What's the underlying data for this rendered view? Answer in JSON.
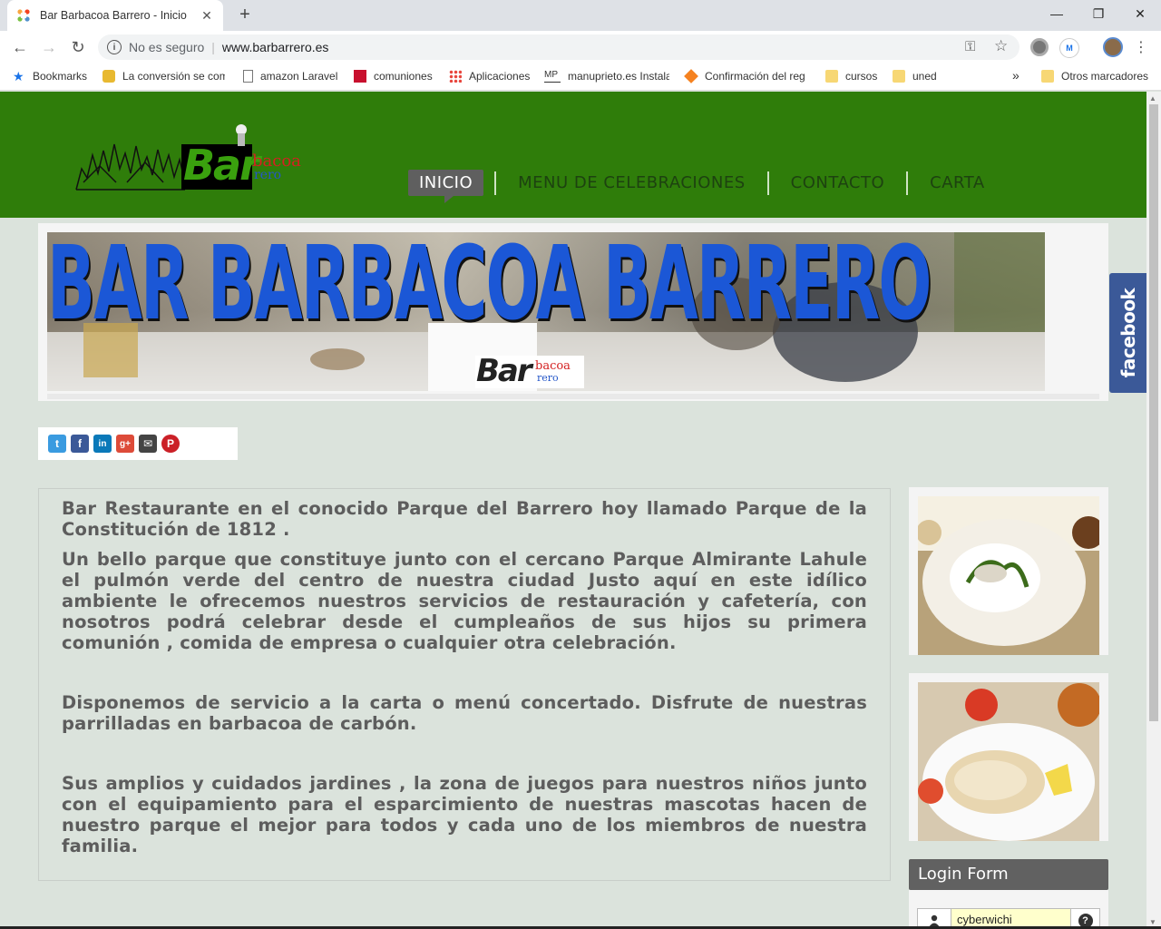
{
  "browser": {
    "tab_title": "Bar Barbacoa Barrero - Inicio",
    "tab_close": "✕",
    "new_tab": "+",
    "window_controls": {
      "minimize": "—",
      "restore": "❐",
      "close": "✕"
    },
    "security_label": "No es seguro",
    "url": "www.barbarrero.es",
    "bookmarks": [
      {
        "label": "Bookmarks",
        "icon": "star-icon"
      },
      {
        "label": "La conversión se com",
        "icon": "folder-icon"
      },
      {
        "label": "amazon Laravel",
        "icon": "page-icon"
      },
      {
        "label": "comuniones",
        "icon": "red-square-icon"
      },
      {
        "label": "Aplicaciones",
        "icon": "apps-icon"
      },
      {
        "label": "manuprieto.es Instala",
        "icon": "mp-icon"
      },
      {
        "label": "Confirmación del reg",
        "icon": "cube-icon"
      },
      {
        "label": "cursos",
        "icon": "folder-icon"
      },
      {
        "label": "uned",
        "icon": "folder-icon"
      },
      {
        "label": "»",
        "icon": "chevron-icon"
      },
      {
        "label": "Otros marcadores",
        "icon": "folder-icon"
      }
    ]
  },
  "site": {
    "logo_text": "Bar",
    "logo_sub1": "bacoa",
    "logo_sub2": "rero",
    "nav": [
      {
        "label": "INICIO",
        "active": true
      },
      {
        "label": "MENU DE CELEBRACIONES",
        "active": false
      },
      {
        "label": "CONTACTO",
        "active": false
      },
      {
        "label": "CARTA",
        "active": false
      }
    ],
    "banner_title": "BAR BARBACOA BARRERO",
    "banner_logo": "Bar",
    "banner_logo_sub1": "bacoa",
    "banner_logo_sub2": "rero",
    "facebook_tab": "facebook",
    "share_icons": [
      "t",
      "f",
      "in",
      "g+",
      "✉",
      "P"
    ],
    "paragraphs": [
      "Bar Restaurante en el conocido Parque del Barrero hoy llamado Parque de la Constitución de 1812 .",
      "Un bello parque que constituye junto con el cercano Parque Almirante Lahule el pulmón verde del centro de nuestra ciudad Justo aquí en este idílico ambiente le ofrecemos nuestros servicios de restauración y cafetería, con nosotros podrá celebrar desde el cumpleaños de sus hijos  su primera comunión , comida de empresa o cualquier otra celebración.",
      "Disponemos de servicio a la carta o menú concertado. Disfrute de nuestras parrilladas en barbacoa de carbón.",
      "Sus amplios y cuidados jardines , la zona de juegos para nuestros niños junto con el equipamiento para el esparcimiento de nuestras mascotas hacen de nuestro parque el mejor para todos y cada uno de los miembros de nuestra familia."
    ],
    "login": {
      "title": "Login Form",
      "username_value": "cyberwichi",
      "help": "?"
    }
  }
}
